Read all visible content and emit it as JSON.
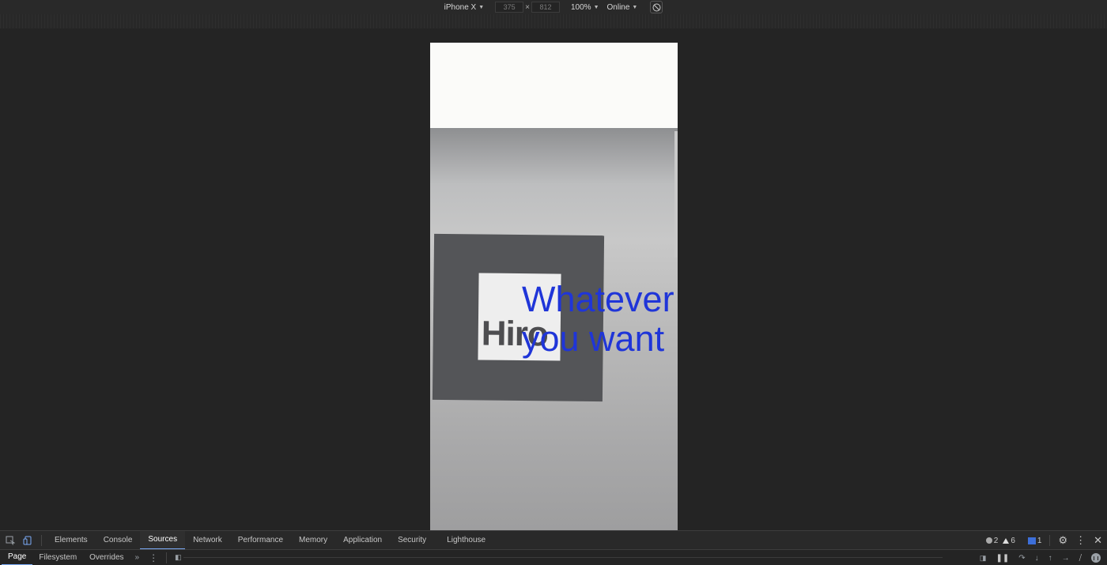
{
  "device_toolbar": {
    "device": "iPhone X",
    "width": "375",
    "height": "812",
    "times": "×",
    "zoom": "100%",
    "network": "Online"
  },
  "viewport": {
    "marker_text": "Hiro",
    "ar_text_line1": "Whatever",
    "ar_text_line2": "you want",
    "ar_text_color": "#1f35d8"
  },
  "devtools": {
    "tabs": [
      "Elements",
      "Console",
      "Sources",
      "Network",
      "Performance",
      "Memory",
      "Application",
      "Security",
      "Lighthouse"
    ],
    "active_tab": "Sources",
    "errors": "2",
    "warnings": "6",
    "issues": "1",
    "sources_subtabs": [
      "Page",
      "Filesystem",
      "Overrides"
    ],
    "more_tabs": "»"
  }
}
